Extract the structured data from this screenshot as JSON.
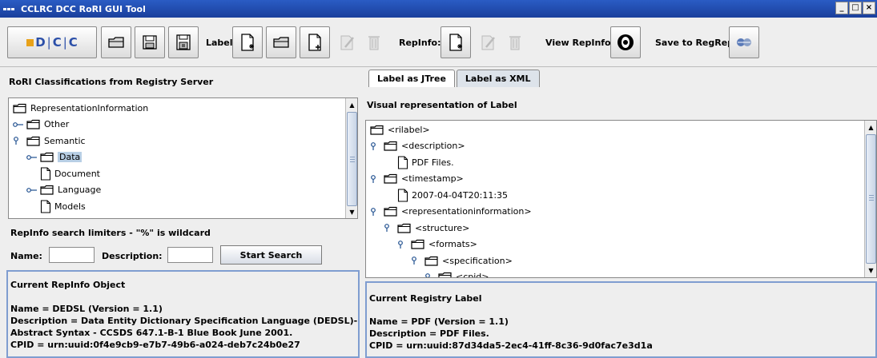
{
  "window": {
    "title": "CCLRC DCC RoRI GUI Tool",
    "minimize": "_",
    "maximize": "□",
    "close": "×"
  },
  "toolbar": {
    "logo_d": "D",
    "logo_c1": "C",
    "logo_c2": "C",
    "logo_sep": "|",
    "label_section": "Label:",
    "repinfo_section": "RepInfo:",
    "view_repinfo": "View RepInfo",
    "save_regrep": "Save to RegRep"
  },
  "left": {
    "title": "RoRI Classifications from Registry Server",
    "tree": [
      {
        "label": "RepresentationInformation",
        "type": "folder",
        "level": 0,
        "handle": "none"
      },
      {
        "label": "Other",
        "type": "folder",
        "level": 1,
        "handle": "collapsed"
      },
      {
        "label": "Semantic",
        "type": "folder",
        "level": 1,
        "handle": "expanded"
      },
      {
        "label": "Data",
        "type": "folder",
        "level": 2,
        "handle": "collapsed",
        "selected": true
      },
      {
        "label": "Document",
        "type": "file",
        "level": 2,
        "handle": "none"
      },
      {
        "label": "Language",
        "type": "folder",
        "level": 2,
        "handle": "collapsed"
      },
      {
        "label": "Models",
        "type": "file",
        "level": 2,
        "handle": "none"
      }
    ],
    "search_title": "RepInfo search limiters - \"%\" is wildcard",
    "name_label": "Name:",
    "description_label": "Description:",
    "search_button": "Start Search",
    "current_title": "Current RepInfo Object",
    "current_lines": [
      "Name = DEDSL (Version = 1.1)",
      "Description = Data Entity Dictionary Specification Language (DEDSL)-",
      "Abstract Syntax - CCSDS 647.1-B-1 Blue Book June 2001.",
      "CPID = urn:uuid:0f4e9cb9-e7b7-49b6-a024-deb7c24b0e27"
    ]
  },
  "right": {
    "tabs": [
      "Label as JTree",
      "Label as XML"
    ],
    "title": "Visual representation of Label",
    "tree": [
      {
        "label": "<rilabel>",
        "type": "folder",
        "level": 0,
        "handle": "none"
      },
      {
        "label": "<description>",
        "type": "folder",
        "level": 1,
        "handle": "expanded"
      },
      {
        "label": "PDF Files.",
        "type": "file",
        "level": 2,
        "handle": "none"
      },
      {
        "label": "<timestamp>",
        "type": "folder",
        "level": 1,
        "handle": "expanded"
      },
      {
        "label": "2007-04-04T20:11:35",
        "type": "file",
        "level": 2,
        "handle": "none"
      },
      {
        "label": "<representationinformation>",
        "type": "folder",
        "level": 1,
        "handle": "expanded"
      },
      {
        "label": "<structure>",
        "type": "folder",
        "level": 2,
        "handle": "expanded"
      },
      {
        "label": "<formats>",
        "type": "folder",
        "level": 3,
        "handle": "expanded"
      },
      {
        "label": "<specification>",
        "type": "folder",
        "level": 4,
        "handle": "expanded"
      },
      {
        "label": "<cpid>",
        "type": "folder",
        "level": 5,
        "handle": "expanded"
      }
    ],
    "current_title": "Current Registry Label",
    "current_lines": [
      "Name = PDF (Version = 1.1)",
      "Description = PDF Files.",
      "CPID = urn:uuid:87d34da5-2ec4-41ff-8c36-9d0fac7e3d1a"
    ]
  }
}
